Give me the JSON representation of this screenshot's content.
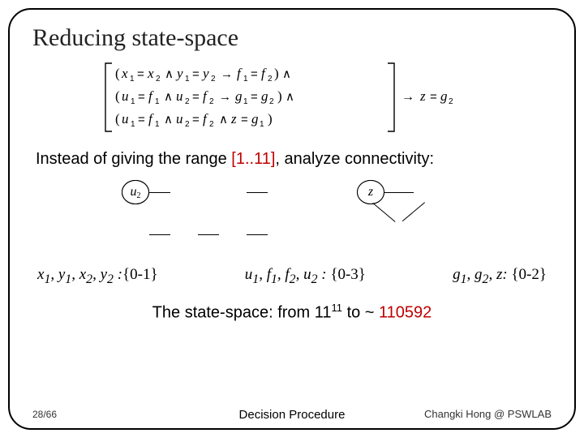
{
  "title": "Reducing state-space",
  "intro_prefix": "Instead of giving the range ",
  "intro_range": "[1..11]",
  "intro_suffix": ", analyze connectivity:",
  "nodes": {
    "x1": "x",
    "x1s": "1",
    "x2": "x",
    "x2s": "2",
    "y1": "y",
    "y1s": "1",
    "y2": "y",
    "y2s": "2",
    "u1": "u",
    "u1s": "1",
    "f1": "f",
    "f1s": "1",
    "f2": "f",
    "f2s": "2",
    "u2": "u",
    "u2s": "2",
    "g1": "g",
    "g1s": "1",
    "g2": "g",
    "g2s": "2",
    "z": "z"
  },
  "ranges": {
    "group1_vars": "x₁, y₁, x₂, y₂ :",
    "group1_val": "{0-1}",
    "group2_vars": "u₁, f₁, f₂, u₂ : ",
    "group2_val": "{0-3}",
    "group3_vars": "g₁, g₂, z: ",
    "group3_val": "{0-2}"
  },
  "statespace_prefix": "The state-space: from 11",
  "statespace_exp": "11",
  "statespace_mid": " to ~ ",
  "statespace_val": "110592",
  "footer": {
    "page": "28/66",
    "center": "Decision Procedure",
    "credit": "Changki Hong @ PSWLAB"
  }
}
